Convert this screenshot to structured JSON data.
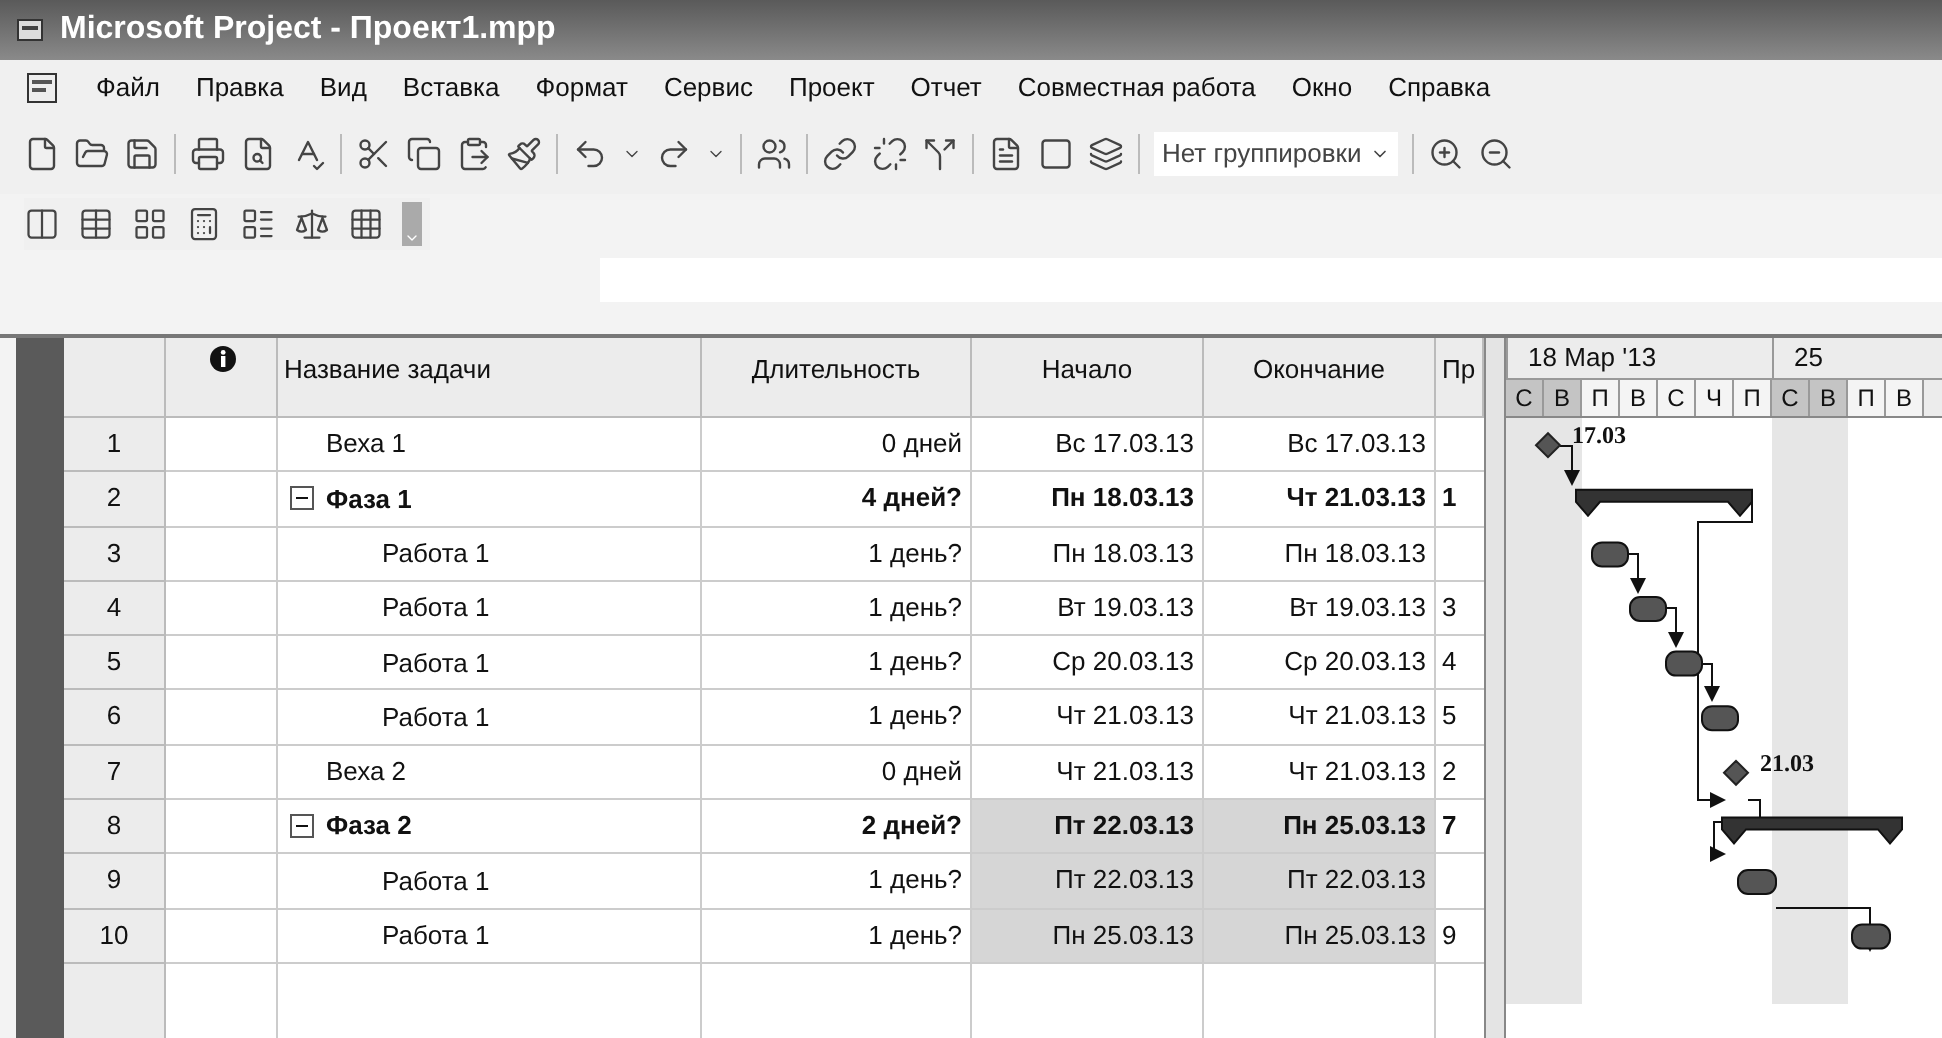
{
  "window": {
    "title": "Microsoft Project - Проект1.mpp"
  },
  "menu": [
    "Файл",
    "Правка",
    "Вид",
    "Вставка",
    "Формат",
    "Сервис",
    "Проект",
    "Отчет",
    "Совместная работа",
    "Окно",
    "Справка"
  ],
  "toolbar": {
    "grouping": {
      "value": "Нет группировки"
    }
  },
  "table": {
    "columns": [
      "Название задачи",
      "Длительность",
      "Начало",
      "Окончание",
      "Пр"
    ],
    "tasks": [
      {
        "id": "1",
        "kind": "milestone",
        "name": "Веха 1",
        "duration": "0 дней",
        "start": "Вс 17.03.13",
        "finish": "Вс 17.03.13",
        "highlighted": false,
        "gantt_label": "17.03"
      },
      {
        "id": "2",
        "kind": "summary",
        "name": "Фаза 1",
        "expanded": true,
        "duration": "4 дней?",
        "start": "Пн 18.03.13",
        "finish": "Чт 21.03.13",
        "predecessors": "1",
        "highlighted": false,
        "children": [
          {
            "id": "3",
            "kind": "task",
            "name": "Работа 1",
            "duration": "1 день?",
            "start": "Пн 18.03.13",
            "finish": "Пн 18.03.13",
            "highlighted": false
          },
          {
            "id": "4",
            "kind": "task",
            "name": "Работа 1",
            "duration": "1 день?",
            "start": "Вт 19.03.13",
            "finish": "Вт 19.03.13",
            "predecessors": "3",
            "highlighted": false
          },
          {
            "id": "5",
            "kind": "task",
            "name": "Работа 1",
            "duration": "1 день?",
            "start": "Ср 20.03.13",
            "finish": "Ср 20.03.13",
            "predecessors": "4",
            "highlighted": false
          },
          {
            "id": "6",
            "kind": "task",
            "name": "Работа 1",
            "duration": "1 день?",
            "start": "Чт 21.03.13",
            "finish": "Чт 21.03.13",
            "predecessors": "5",
            "highlighted": false
          }
        ]
      },
      {
        "id": "7",
        "kind": "milestone",
        "name": "Веха 2",
        "duration": "0 дней",
        "start": "Чт 21.03.13",
        "finish": "Чт 21.03.13",
        "predecessors": "2",
        "highlighted": false,
        "gantt_label": "21.03"
      },
      {
        "id": "8",
        "kind": "summary",
        "name": "Фаза 2",
        "expanded": true,
        "duration": "2 дней?",
        "start": "Пт 22.03.13",
        "finish": "Пн 25.03.13",
        "predecessors": "7",
        "highlighted": true,
        "children": [
          {
            "id": "9",
            "kind": "task",
            "name": "Работа 1",
            "duration": "1 день?",
            "start": "Пт 22.03.13",
            "finish": "Пт 22.03.13",
            "highlighted": true
          },
          {
            "id": "10",
            "kind": "task",
            "name": "Работа 1",
            "duration": "1 день?",
            "start": "Пн 25.03.13",
            "finish": "Пн 25.03.13",
            "predecessors": "9",
            "highlighted": true
          }
        ]
      }
    ]
  },
  "gantt": {
    "weeks": [
      "18 Мар '13",
      "25"
    ],
    "days": [
      {
        "label": "С",
        "weekend": true
      },
      {
        "label": "В",
        "weekend": true
      },
      {
        "label": "П",
        "weekend": false
      },
      {
        "label": "В",
        "weekend": false
      },
      {
        "label": "С",
        "weekend": false
      },
      {
        "label": "Ч",
        "weekend": false
      },
      {
        "label": "П",
        "weekend": false
      },
      {
        "label": "С",
        "weekend": true
      },
      {
        "label": "В",
        "weekend": true
      },
      {
        "label": "П",
        "weekend": false
      },
      {
        "label": "В",
        "weekend": false
      }
    ]
  }
}
